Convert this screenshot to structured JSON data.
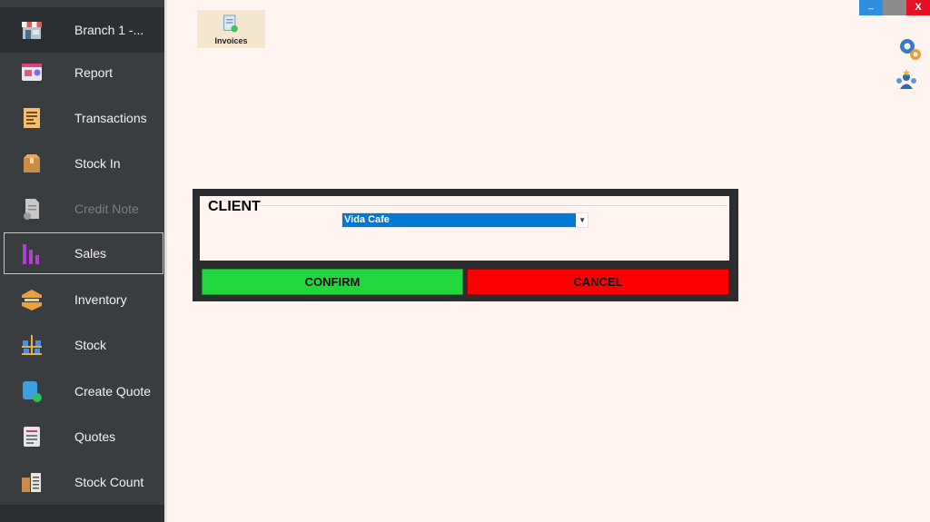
{
  "sidebar": {
    "branch_label": "Branch 1 -...",
    "items": [
      {
        "label": "Report",
        "icon": "report-icon"
      },
      {
        "label": "Transactions",
        "icon": "transactions-icon"
      },
      {
        "label": "Stock In",
        "icon": "box-icon"
      },
      {
        "label": "Credit Note",
        "icon": "credit-note-icon",
        "disabled": true
      },
      {
        "label": "Sales",
        "icon": "sales-chart-icon",
        "active": true
      },
      {
        "label": "Inventory",
        "icon": "inventory-icon"
      },
      {
        "label": "Stock",
        "icon": "stock-shelf-icon"
      },
      {
        "label": "Create Quote",
        "icon": "create-quote-icon"
      },
      {
        "label": "Quotes",
        "icon": "quotes-icon"
      },
      {
        "label": "Stock Count",
        "icon": "stock-count-icon"
      }
    ]
  },
  "toolbar": {
    "invoices_label": "Invoices"
  },
  "window": {
    "minimize_label": "_",
    "close_label": "X"
  },
  "dialog": {
    "client_title": "CLIENT",
    "client_value": "Vida Cafe",
    "confirm_label": "CONFIRM",
    "cancel_label": "CANCEL"
  },
  "colors": {
    "background": "#fff4ef",
    "sidebar": "#3a3d40",
    "confirm": "#21d63f",
    "cancel": "#ff0000",
    "selection": "#0078d7"
  }
}
